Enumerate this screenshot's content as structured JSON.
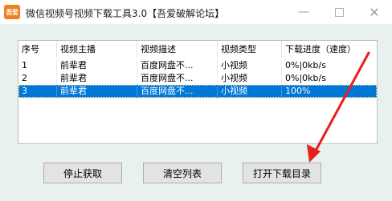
{
  "window": {
    "icon_text": "吾爱",
    "title": "微信视频号视频下载工具3.0【吾爱破解论坛】",
    "min_glyph": "—",
    "close_glyph": "✕"
  },
  "table": {
    "columns": [
      "序号",
      "视频主播",
      "视频描述",
      "视频类型",
      "下载进度（速度）"
    ],
    "rows": [
      [
        "1",
        "前辈君",
        "百度网盘不...",
        "小视频",
        "0%|0kb/s"
      ],
      [
        "2",
        "前辈君",
        "百度网盘不...",
        "小视频",
        "0%|0kb/s"
      ],
      [
        "3",
        "前辈君",
        "百度网盘不...",
        "小视频",
        "100%"
      ]
    ],
    "selected_row": 3
  },
  "buttons": {
    "stop": "停止获取",
    "clear": "清空列表",
    "open_dir": "打开下载目录"
  },
  "colors": {
    "selection": "#0078d7",
    "annotation_arrow": "#e8201b"
  }
}
